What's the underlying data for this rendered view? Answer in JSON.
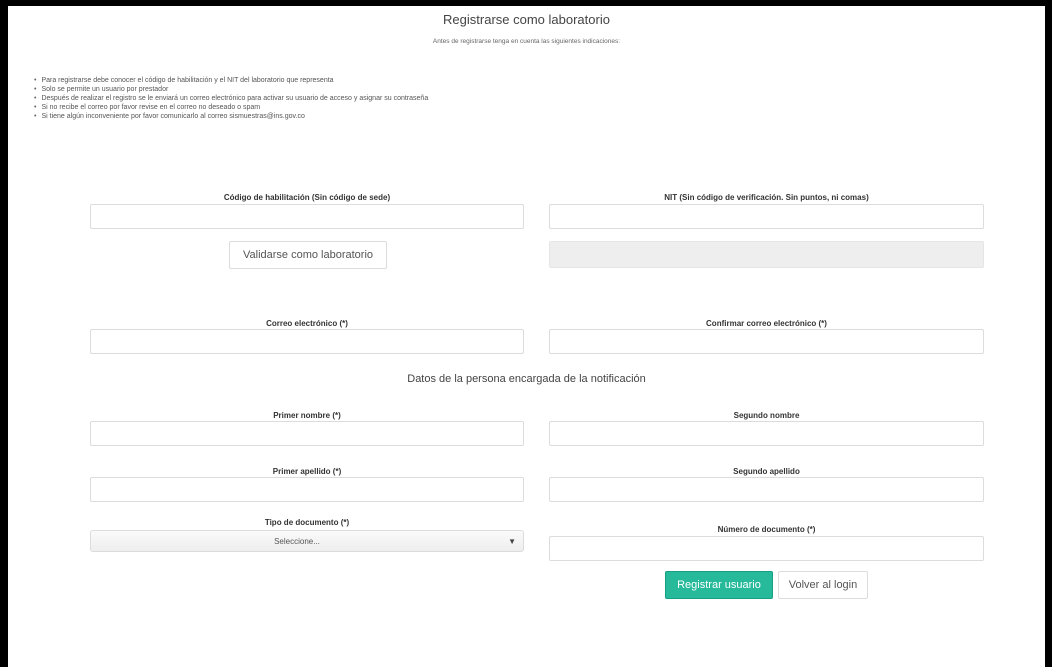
{
  "header": {
    "title": "Registrarse como laboratorio",
    "subtitle": "Antes de registrarse tenga en cuenta las siguientes indicaciones:"
  },
  "notes": [
    "Para registrarse debe conocer el código de habilitación y el NIT del laboratorio que representa",
    "Solo se permite un usuario por prestador",
    "Después de realizar el registro se le enviará un correo electrónico para activar su usuario de acceso y asignar su contraseña",
    "Si no recibe el correo por favor revise en el correo no deseado o spam",
    "Si tiene algún inconveniente por favor comunicarlo al correo sismuestras@ins.gov.co"
  ],
  "form": {
    "codigo_label": "Código de habilitación (Sin código de sede)",
    "codigo_value": "",
    "nit_label": "NIT (Sin código de verificación. Sin puntos, ni comas)",
    "nit_value": "",
    "validate_button": "Validarse como laboratorio",
    "email_label": "Correo electrónico (*)",
    "email_value": "",
    "confirm_email_label": "Confirmar correo electrónico (*)",
    "confirm_email_value": "",
    "section_title": "Datos de la persona encargada de la notificación",
    "first_name_label": "Primer nombre (*)",
    "second_name_label": "Segundo nombre",
    "first_surname_label": "Primer apellido (*)",
    "second_surname_label": "Segundo apellido",
    "doc_type_label": "Tipo de documento (*)",
    "doc_type_selected": "Seleccione...",
    "doc_number_label": "Número de documento (*)",
    "register_button": "Registrar usuario",
    "back_button": "Volver al login"
  },
  "icons": {
    "select_arrow": "caret-down-icon"
  },
  "colors": {
    "primary_button": "#26b99a"
  }
}
